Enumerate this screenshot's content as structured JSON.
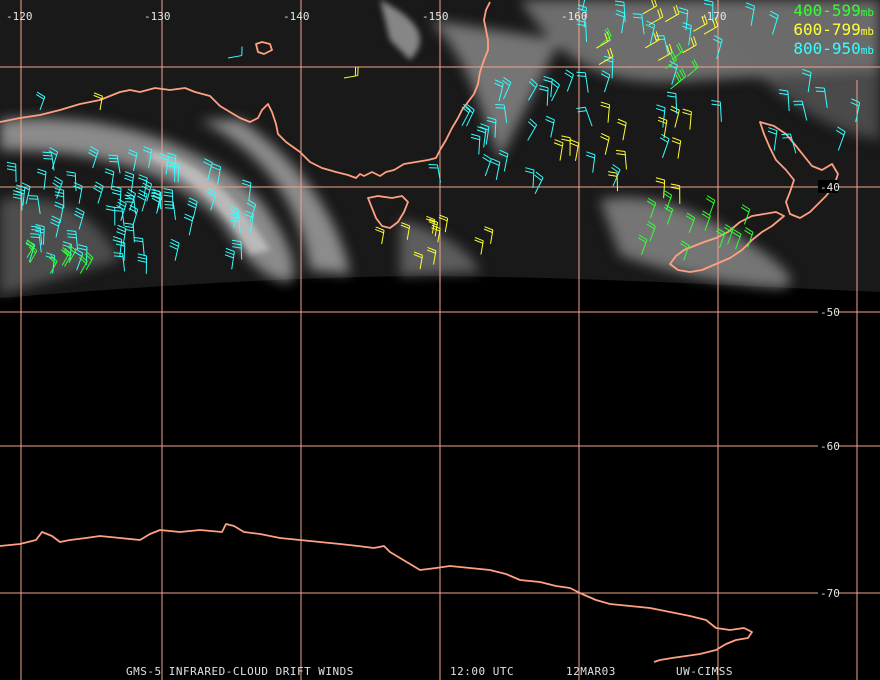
{
  "legend": [
    {
      "range": "400-599",
      "unit": "mb",
      "color": "#33ff33"
    },
    {
      "range": "600-799",
      "unit": "mb",
      "color": "#ffff33"
    },
    {
      "range": "800-950",
      "unit": "mb",
      "color": "#33ffff"
    }
  ],
  "longitude_labels": [
    "-120",
    "-130",
    "-140",
    "-150",
    "-160",
    "-170"
  ],
  "latitude_labels": [
    "-40",
    "-50",
    "-60",
    "-70"
  ],
  "footer": {
    "product": "GMS-5 INFRARED-CLOUD DRIFT WINDS",
    "time": "12:00 UTC",
    "date": "12MAR03",
    "source": "UW-CIMSS"
  },
  "colors": {
    "grid": "#f2a48c",
    "coast": "#ffa080",
    "background": "#000000"
  }
}
